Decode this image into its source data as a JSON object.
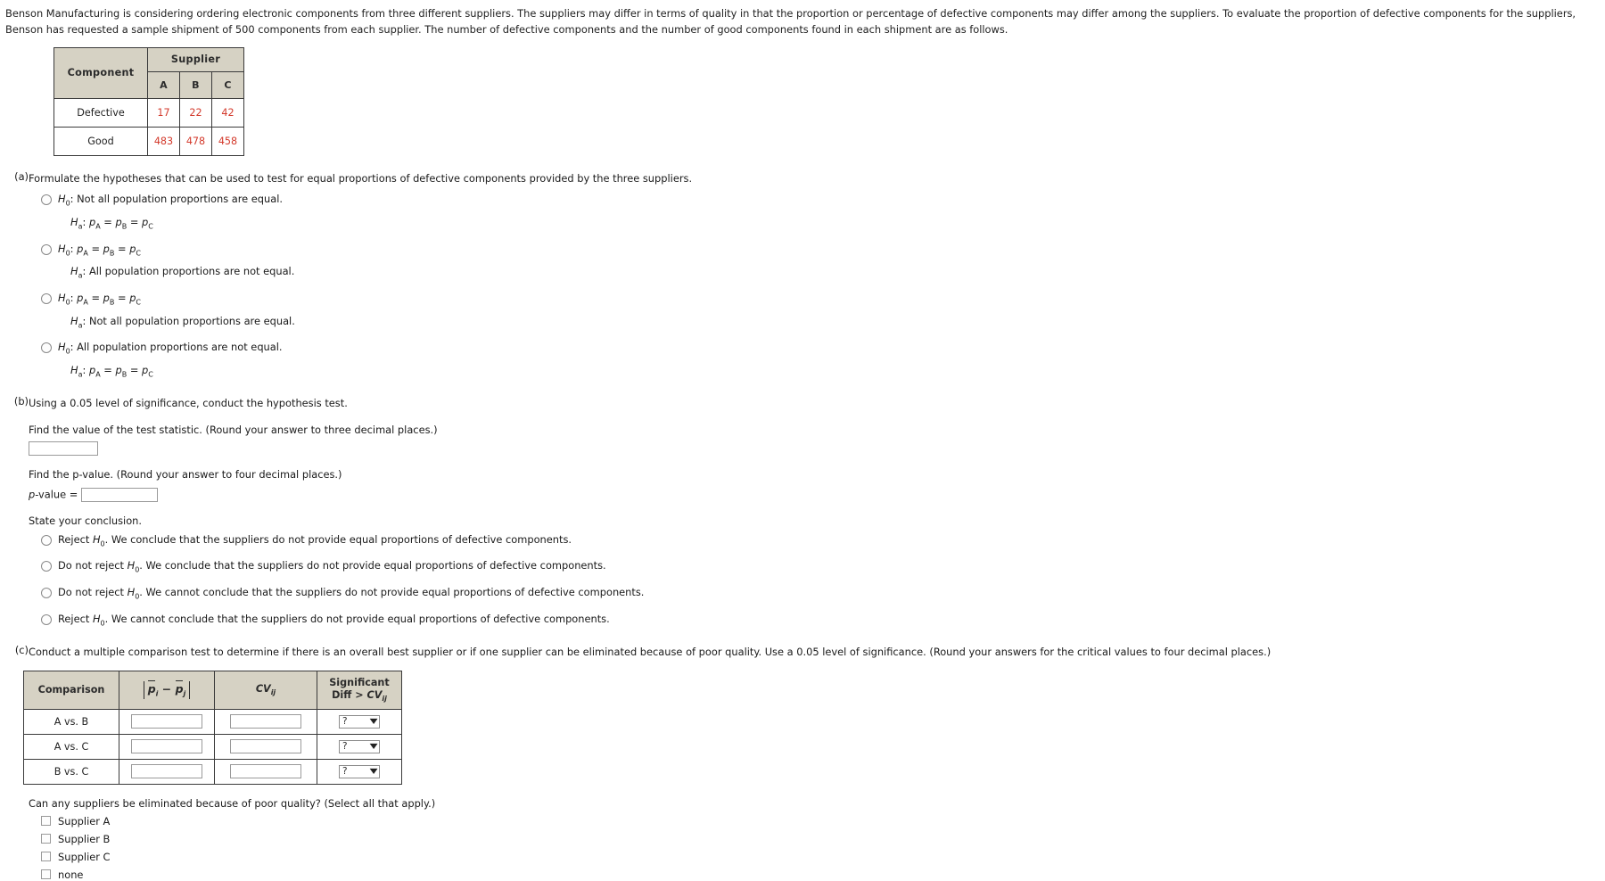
{
  "intro": "Benson Manufacturing is considering ordering electronic components from three different suppliers. The suppliers may differ in terms of quality in that the proportion or percentage of defective components may differ among the suppliers. To evaluate the proportion of defective components for the suppliers, Benson has requested a sample shipment of 500 components from each supplier. The number of defective components and the number of good components found in each shipment are as follows.",
  "data_table": {
    "component_header": "Component",
    "supplier_header": "Supplier",
    "suppliers": [
      "A",
      "B",
      "C"
    ],
    "rows": [
      {
        "label": "Defective",
        "values": [
          "17",
          "22",
          "42"
        ]
      },
      {
        "label": "Good",
        "values": [
          "483",
          "478",
          "458"
        ]
      }
    ]
  },
  "part_a": {
    "label": "(a)",
    "question": "Formulate the hypotheses that can be used to test for equal proportions of defective components provided by the three suppliers.",
    "options": [
      {
        "null": "H0: Not all population proportions are equal.",
        "alt": "Ha: pA = pB = pC"
      },
      {
        "null": "H0: pA = pB = pC",
        "alt": "Ha: All population proportions are not equal."
      },
      {
        "null": "H0: pA = pB = pC",
        "alt": "Ha: Not all population proportions are equal."
      },
      {
        "null": "H0: All population proportions are not equal.",
        "alt": "Ha: pA = pB = pC"
      }
    ]
  },
  "part_b": {
    "label": "(b)",
    "question": "Using a 0.05 level of significance, conduct the hypothesis test.",
    "test_stat_prompt": "Find the value of the test statistic. (Round your answer to three decimal places.)",
    "test_stat_value": "",
    "pvalue_prompt": "Find the p-value. (Round your answer to four decimal places.)",
    "pvalue_label": "p-value =",
    "pvalue_value": "",
    "conclusion_prompt": "State your conclusion.",
    "conclusions": [
      "Reject H0. We conclude that the suppliers do not provide equal proportions of defective components.",
      "Do not reject H0. We conclude that the suppliers do not provide equal proportions of defective components.",
      "Do not reject H0. We cannot conclude that the suppliers do not provide equal proportions of defective components.",
      "Reject H0. We cannot conclude that the suppliers do not provide equal proportions of defective components."
    ]
  },
  "part_c": {
    "label": "(c)",
    "question": "Conduct a multiple comparison test to determine if there is an overall best supplier or if one supplier can be eliminated because of poor quality. Use a 0.05 level of significance. (Round your answers for the critical values to four decimal places.)",
    "table": {
      "headers": {
        "comparison": "Comparison",
        "diff": "|pi - pj|",
        "cv": "CVij",
        "significant": "Significant Diff > CVij"
      },
      "rows": [
        {
          "comparison": "A vs. B",
          "diff": "",
          "cv": "",
          "significant": "?"
        },
        {
          "comparison": "A vs. C",
          "diff": "",
          "cv": "",
          "significant": "?"
        },
        {
          "comparison": "B vs. C",
          "diff": "",
          "cv": "",
          "significant": "?"
        }
      ]
    },
    "checkbox_prompt": "Can any suppliers be eliminated because of poor quality? (Select all that apply.)",
    "checkboxes": [
      "Supplier A",
      "Supplier B",
      "Supplier C",
      "none"
    ]
  }
}
